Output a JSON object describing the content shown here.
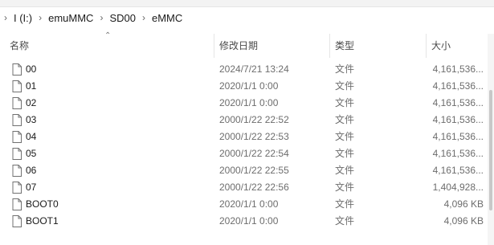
{
  "top_tabs": [
    "",
    "",
    "",
    ""
  ],
  "breadcrumb": {
    "items": [
      "I (I:)",
      "emuMMC",
      "SD00",
      "eMMC"
    ]
  },
  "columns": {
    "name": "名称",
    "date": "修改日期",
    "type": "类型",
    "size": "大小"
  },
  "files": [
    {
      "name": "00",
      "date": "2024/7/21 13:24",
      "type": "文件",
      "size": "4,161,536..."
    },
    {
      "name": "01",
      "date": "2020/1/1 0:00",
      "type": "文件",
      "size": "4,161,536..."
    },
    {
      "name": "02",
      "date": "2020/1/1 0:00",
      "type": "文件",
      "size": "4,161,536..."
    },
    {
      "name": "03",
      "date": "2000/1/22 22:52",
      "type": "文件",
      "size": "4,161,536..."
    },
    {
      "name": "04",
      "date": "2000/1/22 22:53",
      "type": "文件",
      "size": "4,161,536..."
    },
    {
      "name": "05",
      "date": "2000/1/22 22:54",
      "type": "文件",
      "size": "4,161,536..."
    },
    {
      "name": "06",
      "date": "2000/1/22 22:55",
      "type": "文件",
      "size": "4,161,536..."
    },
    {
      "name": "07",
      "date": "2000/1/22 22:56",
      "type": "文件",
      "size": "1,404,928..."
    },
    {
      "name": "BOOT0",
      "date": "2020/1/1 0:00",
      "type": "文件",
      "size": "4,096 KB"
    },
    {
      "name": "BOOT1",
      "date": "2020/1/1 0:00",
      "type": "文件",
      "size": "4,096 KB"
    }
  ],
  "icons": {
    "file": "file-icon",
    "chevron": "chevron-right-icon",
    "sort": "sort-up-icon"
  }
}
